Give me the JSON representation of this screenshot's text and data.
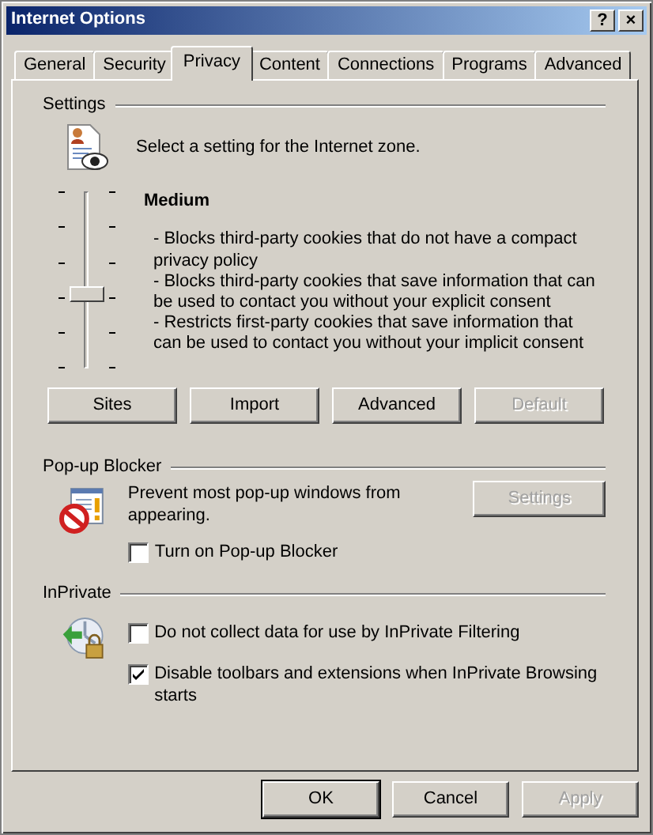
{
  "window": {
    "title": "Internet Options",
    "title_buttons": [
      "?",
      "×"
    ]
  },
  "tabs": [
    {
      "label": "General",
      "selected": false
    },
    {
      "label": "Security",
      "selected": false
    },
    {
      "label": "Privacy",
      "selected": true
    },
    {
      "label": "Content",
      "selected": false
    },
    {
      "label": "Connections",
      "selected": false
    },
    {
      "label": "Programs",
      "selected": false
    },
    {
      "label": "Advanced",
      "selected": false
    }
  ],
  "settings": {
    "heading": "Settings",
    "prompt": "Select a setting for the Internet zone.",
    "slider": {
      "level": 0.4
    },
    "level_name": "Medium",
    "description": [
      "- Blocks third-party cookies that do not have a compact privacy policy",
      "- Blocks third-party cookies that save information that can be used to contact you without your explicit consent",
      "- Restricts first-party cookies that save information that can be used to contact you without your implicit consent"
    ],
    "buttons": [
      {
        "label": "Sites",
        "disabled": false
      },
      {
        "label": "Import",
        "disabled": false
      },
      {
        "label": "Advanced",
        "disabled": false
      },
      {
        "label": "Default",
        "disabled": true
      }
    ]
  },
  "popup_blocker": {
    "heading": "Pop-up Blocker",
    "text": "Prevent most pop-up windows from appearing.",
    "button": {
      "label": "Settings",
      "disabled": true
    },
    "checkboxes": [
      {
        "label": "Turn on Pop-up Blocker",
        "checked": false
      }
    ]
  },
  "inprivate": {
    "heading": "InPrivate",
    "checkboxes": [
      {
        "label": "Do not collect data for use by InPrivate Filtering",
        "checked": false
      },
      {
        "label": "Disable toolbars and extensions when InPrivate Browsing starts",
        "checked": true
      }
    ]
  },
  "footer_buttons": [
    {
      "label": "OK",
      "disabled": false,
      "default": true
    },
    {
      "label": "Cancel",
      "disabled": false,
      "default": false
    },
    {
      "label": "Apply",
      "disabled": true,
      "default": false
    }
  ]
}
